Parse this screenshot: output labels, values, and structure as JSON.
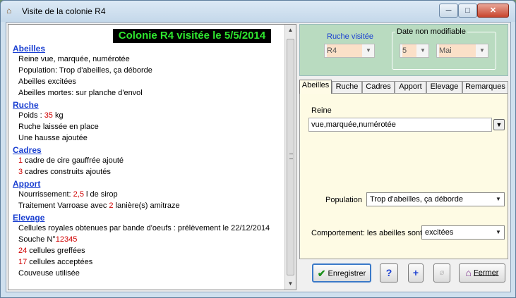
{
  "window": {
    "title": "Visite de la colonie R4",
    "icon": "beehive-icon"
  },
  "report": {
    "title": "Colonie R4 visitée le 5/5/2014",
    "sections": [
      {
        "heading": "Abeilles",
        "lines": [
          {
            "parts": [
              {
                "t": "Reine vue, marquée, numérotée"
              }
            ]
          },
          {
            "parts": [
              {
                "t": "Population: Trop d'abeilles, ça déborde"
              }
            ]
          },
          {
            "parts": [
              {
                "t": "Abeilles excitées"
              }
            ]
          },
          {
            "parts": [
              {
                "t": "Abeilles mortes:  sur planche d'envol"
              }
            ]
          }
        ]
      },
      {
        "heading": "Ruche",
        "lines": [
          {
            "parts": [
              {
                "t": "Poids : "
              },
              {
                "t": "35",
                "red": true
              },
              {
                "t": "  kg"
              }
            ]
          },
          {
            "parts": [
              {
                "t": "Ruche laissée en place"
              }
            ]
          },
          {
            "parts": [
              {
                "t": "Une hausse ajoutée"
              }
            ]
          }
        ]
      },
      {
        "heading": "Cadres",
        "lines": [
          {
            "parts": [
              {
                "t": "1",
                "red": true
              },
              {
                "t": " cadre de cire gauffrée ajouté"
              }
            ]
          },
          {
            "parts": [
              {
                "t": "3",
                "red": true
              },
              {
                "t": " cadres construits ajoutés"
              }
            ]
          }
        ]
      },
      {
        "heading": "Apport",
        "lines": [
          {
            "parts": [
              {
                "t": "Nourrissement: "
              },
              {
                "t": "2,5",
                "red": true
              },
              {
                "t": "   l de sirop"
              }
            ]
          },
          {
            "parts": [
              {
                "t": "Traitement Varroase avec "
              },
              {
                "t": "2",
                "red": true
              },
              {
                "t": "  lanière(s) amitraze"
              }
            ]
          }
        ]
      },
      {
        "heading": "Elevage",
        "lines": [
          {
            "parts": [
              {
                "t": "Cellules royales obtenues par bande d'oeufs :  prélèvement  le 22/12/2014"
              }
            ]
          },
          {
            "parts": [
              {
                "t": "Souche N°"
              },
              {
                "t": "12345",
                "red": true
              }
            ]
          },
          {
            "parts": [
              {
                "t": "24",
                "red": true
              },
              {
                "t": " cellules greffées"
              }
            ]
          },
          {
            "parts": [
              {
                "t": "17",
                "red": true
              },
              {
                "t": " cellules acceptées"
              }
            ]
          },
          {
            "parts": [
              {
                "t": "Couveuse utilisée"
              }
            ]
          }
        ]
      }
    ]
  },
  "header": {
    "ruche_label": "Ruche visitée",
    "ruche_value": "R4",
    "date_group_label": "Date non modifiable",
    "day_value": "5",
    "month_value": "Mai"
  },
  "tabs": [
    "Abeilles",
    "Ruche",
    "Cadres",
    "Apport",
    "Elevage",
    "Remarques"
  ],
  "active_tab": "Abeilles",
  "abeilles_tab": {
    "reine_label": "Reine",
    "reine_value": "vue,marquée,numérotée",
    "population_label": "Population",
    "population_value": "Trop d'abeilles, ça déborde",
    "comportement_label": "Comportement: les abeilles sont",
    "comportement_value": "excitées"
  },
  "buttons": {
    "save": "Enregistrer",
    "help": "?",
    "add": "+",
    "erase": "",
    "close": "Fermer"
  },
  "colors": {
    "report_title_bg": "#000000",
    "report_title_fg": "#2fe62f",
    "section": "#1a3fd1",
    "value": "#d00000",
    "header_bg": "#b9dbc0",
    "tab_bg": "#fefbe4"
  }
}
